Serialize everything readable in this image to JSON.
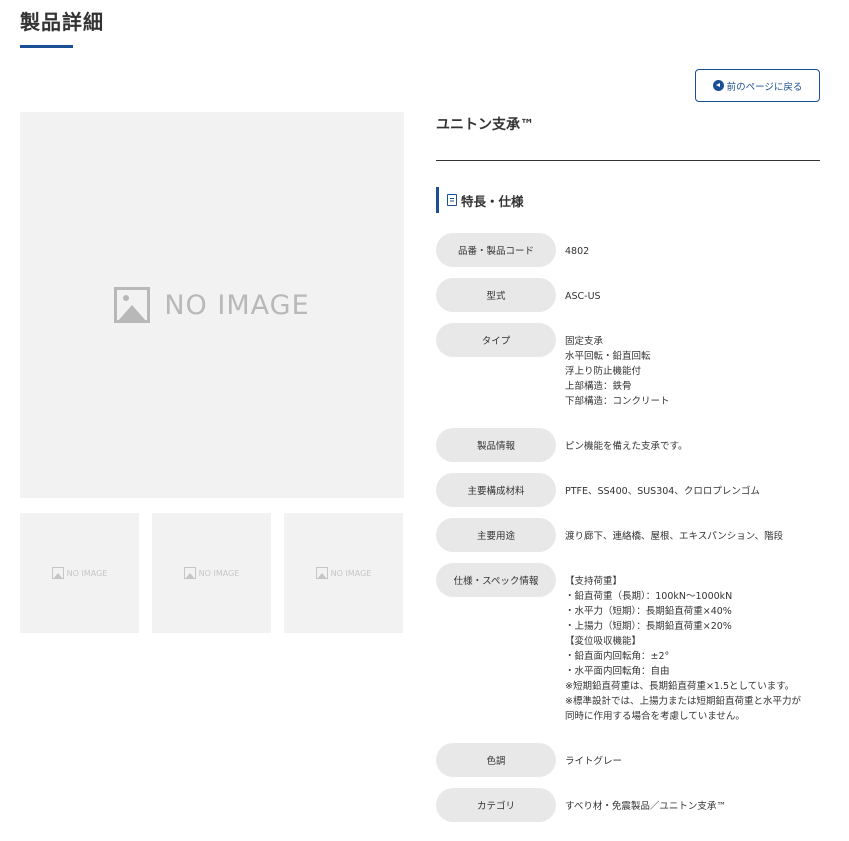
{
  "page": {
    "title": "製品詳細"
  },
  "back_button": {
    "label": "前のページに戻る",
    "icon": "arrow-circle-left-icon"
  },
  "gallery": {
    "main_image_text": "NO IMAGE",
    "thumbnails": [
      {
        "text": "NO IMAGE"
      },
      {
        "text": "NO IMAGE"
      },
      {
        "text": "NO IMAGE"
      }
    ]
  },
  "product": {
    "name": "ユニトン支承™",
    "section_heading": "特長・仕様"
  },
  "specs": [
    {
      "label": "品番・製品コード",
      "value": "4802"
    },
    {
      "label": "型式",
      "value": "ASC-US"
    },
    {
      "label": "タイプ",
      "value": "固定支承\n水平回転・鉛直回転\n浮上り防止機能付\n上部構造：鉄骨\n下部構造：コンクリート"
    },
    {
      "label": "製品情報",
      "value": "ピン機能を備えた支承です。"
    },
    {
      "label": "主要構成材料",
      "value": "PTFE、SS400、SUS304、クロロプレンゴム"
    },
    {
      "label": "主要用途",
      "value": "渡り廊下、連絡橋、屋根、エキスパンション、階段"
    },
    {
      "label": "仕様・スペック情報",
      "value": "【支持荷重】\n・鉛直荷重（長期）：100kN～1000kN\n・水平力（短期）：長期鉛直荷重×40%\n・上揚力（短期）：長期鉛直荷重×20%\n【変位吸収機能】\n・鉛直面内回転角：±2°\n・水平面内回転角：自由\n※短期鉛直荷重は、長期鉛直荷重×1.5としています。\n※標準設計では、上揚力または短期鉛直荷重と水平力が\n同時に作用する場合を考慮していません。"
    },
    {
      "label": "色調",
      "value": "ライトグレー"
    },
    {
      "label": "カテゴリ",
      "value": "すべり材・免震製品／ユニトン支承™"
    }
  ],
  "colors": {
    "accent": "#1a4f96",
    "label_bg": "#e8e8e8",
    "placeholder_bg": "#f2f2f2"
  }
}
